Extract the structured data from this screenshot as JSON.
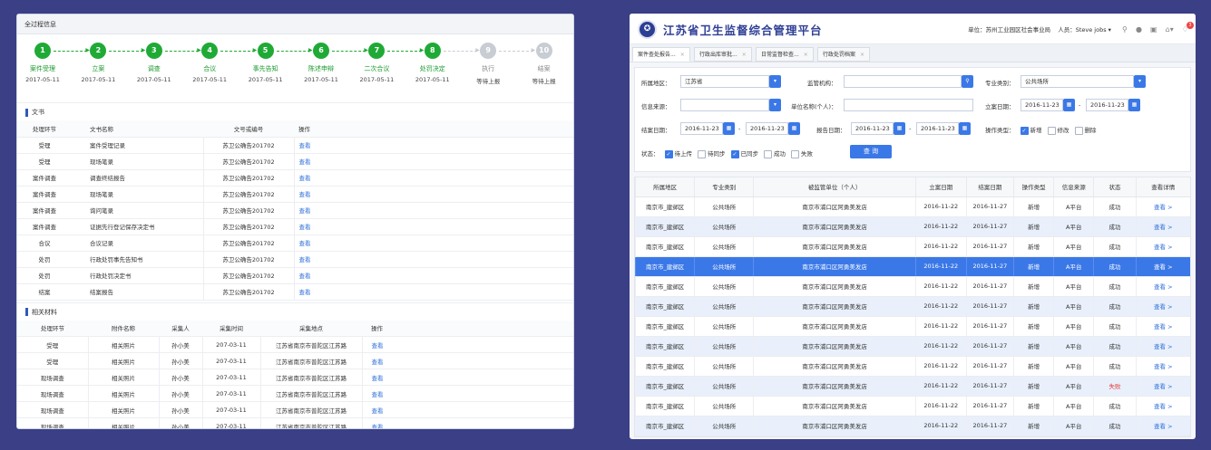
{
  "left_panel": {
    "title": "全过程信息",
    "steps": [
      {
        "num": "1",
        "name": "案件受理",
        "date": "2017-05-11",
        "done": true
      },
      {
        "num": "2",
        "name": "立案",
        "date": "2017-05-11",
        "done": true
      },
      {
        "num": "3",
        "name": "调查",
        "date": "2017-05-11",
        "done": true
      },
      {
        "num": "4",
        "name": "合议",
        "date": "2017-05-11",
        "done": true
      },
      {
        "num": "5",
        "name": "事先告知",
        "date": "2017-05-11",
        "done": true
      },
      {
        "num": "6",
        "name": "陈述申辩",
        "date": "2017-05-11",
        "done": true
      },
      {
        "num": "7",
        "name": "二次合议",
        "date": "2017-05-11",
        "done": true
      },
      {
        "num": "8",
        "name": "处罚决定",
        "date": "2017-05-11",
        "done": true
      },
      {
        "num": "9",
        "name": "执行",
        "date": "等待上报",
        "done": false
      },
      {
        "num": "10",
        "name": "结案",
        "date": "等待上报",
        "done": false
      }
    ],
    "documents": {
      "section_title": "文书",
      "headers": [
        "处理环节",
        "文书名称",
        "文号或编号",
        "操作"
      ],
      "rows": [
        {
          "stage": "受理",
          "name": "案件受理记录",
          "number": "苏卫公确告201702",
          "action": "查看"
        },
        {
          "stage": "受理",
          "name": "现场笔录",
          "number": "苏卫公确告201702",
          "action": "查看"
        },
        {
          "stage": "案件调查",
          "name": "调查终结报告",
          "number": "苏卫公确告201702",
          "action": "查看"
        },
        {
          "stage": "案件调查",
          "name": "现场笔录",
          "number": "苏卫公确告201702",
          "action": "查看"
        },
        {
          "stage": "案件调查",
          "name": "询问笔录",
          "number": "苏卫公确告201702",
          "action": "查看"
        },
        {
          "stage": "案件调查",
          "name": "证据先行登记保存决定书",
          "number": "苏卫公确告201702",
          "action": "查看"
        },
        {
          "stage": "合议",
          "name": "合议记录",
          "number": "苏卫公确告201702",
          "action": "查看"
        },
        {
          "stage": "处罚",
          "name": "行政处罚事先告知书",
          "number": "苏卫公确告201702",
          "action": "查看"
        },
        {
          "stage": "处罚",
          "name": "行政处罚决定书",
          "number": "苏卫公确告201702",
          "action": "查看"
        },
        {
          "stage": "结案",
          "name": "结案报告",
          "number": "苏卫公确告201702",
          "action": "查看"
        }
      ]
    },
    "materials": {
      "section_title": "相关材料",
      "headers": [
        "处理环节",
        "附件名称",
        "采集人",
        "采集时间",
        "采集地点",
        "操作"
      ],
      "rows": [
        {
          "stage": "受理",
          "name": "相关照片",
          "collector": "孙小美",
          "time": "207-03-11",
          "place": "江苏省南京市普陀区江苏路",
          "action": "查看"
        },
        {
          "stage": "受理",
          "name": "相关照片",
          "collector": "孙小美",
          "time": "207-03-11",
          "place": "江苏省南京市普陀区江苏路",
          "action": "查看"
        },
        {
          "stage": "现场调查",
          "name": "相关照片",
          "collector": "孙小美",
          "time": "207-03-11",
          "place": "江苏省南京市普陀区江苏路",
          "action": "查看"
        },
        {
          "stage": "现场调查",
          "name": "相关照片",
          "collector": "孙小美",
          "time": "207-03-11",
          "place": "江苏省南京市普陀区江苏路",
          "action": "查看"
        },
        {
          "stage": "现场调查",
          "name": "相关照片",
          "collector": "孙小美",
          "time": "207-03-11",
          "place": "江苏省南京市普陀区江苏路",
          "action": "查看"
        },
        {
          "stage": "现场调查",
          "name": "相关照片",
          "collector": "孙小美",
          "time": "207-03-11",
          "place": "江苏省南京市普陀区江苏路",
          "action": "查看"
        }
      ]
    }
  },
  "right_panel": {
    "app_title": "江苏省卫生监督综合管理平台",
    "unit_label": "单位：苏州工业园区社会事业局",
    "person_label": "人员：Steve jobs",
    "person_caret": "▾",
    "badge_count": "3",
    "icons": {
      "search": "search-icon",
      "chat": "chat-icon",
      "message": "message-icon",
      "home": "home-icon",
      "bell": "bell-icon"
    },
    "tabs": [
      "案件查处报告...",
      "行政出库审批...",
      "日常监督检查...",
      "行政处罚档案"
    ],
    "tab_close": "×",
    "filters": {
      "region_label": "所属地区：",
      "region_value": "江苏省",
      "agency_label": "监管机构：",
      "agency_value": "",
      "category_label": "专业类别：",
      "category_value": "公共场所",
      "source_label": "信息来源：",
      "source_value": "",
      "unit_label": "单位名称(个人)：",
      "unit_value": "",
      "filing_date_label": "立案日期：",
      "filing_from": "2016-11-23",
      "filing_to": "2016-11-23",
      "close_date_label": "结案日期：",
      "close_from": "2016-11-23",
      "close_to": "2016-11-23",
      "report_date_label": "报告日期：",
      "report_from": "2016-11-23",
      "report_to": "2016-11-23",
      "range_sep": "-",
      "op_type_label": "操作类型：",
      "op_types": [
        {
          "label": "新增",
          "checked": true
        },
        {
          "label": "修改",
          "checked": false
        },
        {
          "label": "删除",
          "checked": false
        }
      ],
      "status_label": "状态：",
      "statuses": [
        {
          "label": "待上传",
          "checked": true
        },
        {
          "label": "待同步",
          "checked": false
        },
        {
          "label": "已同步",
          "checked": true
        },
        {
          "label": "成功",
          "checked": false
        },
        {
          "label": "失败",
          "checked": false
        }
      ],
      "query_button": "查 询"
    },
    "table": {
      "headers": [
        "所属地区",
        "专业类别",
        "被监管单位（个人）",
        "立案日期",
        "结案日期",
        "操作类型",
        "信息来源",
        "状态",
        "查看详情"
      ],
      "rows": [
        {
          "region": "南京市_建邺区",
          "category": "公共场所",
          "unit": "南京市浦口区阿勇美发店",
          "filed": "2016-11-22",
          "closed": "2016-11-27",
          "op": "新增",
          "source": "A平台",
          "status": "成功",
          "detail": "查看 >",
          "style": ""
        },
        {
          "region": "南京市_建邺区",
          "category": "公共场所",
          "unit": "南京市浦口区阿勇美发店",
          "filed": "2016-11-22",
          "closed": "2016-11-27",
          "op": "新增",
          "source": "A平台",
          "status": "成功",
          "detail": "查看 >",
          "style": "alt"
        },
        {
          "region": "南京市_建邺区",
          "category": "公共场所",
          "unit": "南京市浦口区阿勇美发店",
          "filed": "2016-11-22",
          "closed": "2016-11-27",
          "op": "新增",
          "source": "A平台",
          "status": "成功",
          "detail": "查看 >",
          "style": ""
        },
        {
          "region": "南京市_建邺区",
          "category": "公共场所",
          "unit": "南京市浦口区阿勇美发店",
          "filed": "2016-11-22",
          "closed": "2016-11-27",
          "op": "新增",
          "source": "A平台",
          "status": "成功",
          "detail": "查看 >",
          "style": "sel"
        },
        {
          "region": "南京市_建邺区",
          "category": "公共场所",
          "unit": "南京市浦口区阿勇美发店",
          "filed": "2016-11-22",
          "closed": "2016-11-27",
          "op": "新增",
          "source": "A平台",
          "status": "成功",
          "detail": "查看 >",
          "style": ""
        },
        {
          "region": "南京市_建邺区",
          "category": "公共场所",
          "unit": "南京市浦口区阿勇美发店",
          "filed": "2016-11-22",
          "closed": "2016-11-27",
          "op": "新增",
          "source": "A平台",
          "status": "成功",
          "detail": "查看 >",
          "style": "alt"
        },
        {
          "region": "南京市_建邺区",
          "category": "公共场所",
          "unit": "南京市浦口区阿勇美发店",
          "filed": "2016-11-22",
          "closed": "2016-11-27",
          "op": "新增",
          "source": "A平台",
          "status": "成功",
          "detail": "查看 >",
          "style": ""
        },
        {
          "region": "南京市_建邺区",
          "category": "公共场所",
          "unit": "南京市浦口区阿勇美发店",
          "filed": "2016-11-22",
          "closed": "2016-11-27",
          "op": "新增",
          "source": "A平台",
          "status": "成功",
          "detail": "查看 >",
          "style": "alt"
        },
        {
          "region": "南京市_建邺区",
          "category": "公共场所",
          "unit": "南京市浦口区阿勇美发店",
          "filed": "2016-11-22",
          "closed": "2016-11-27",
          "op": "新增",
          "source": "A平台",
          "status": "成功",
          "detail": "查看 >",
          "style": ""
        },
        {
          "region": "南京市_建邺区",
          "category": "公共场所",
          "unit": "南京市浦口区阿勇美发店",
          "filed": "2016-11-22",
          "closed": "2016-11-27",
          "op": "新增",
          "source": "A平台",
          "status": "失败",
          "detail": "查看 >",
          "style": "alt"
        },
        {
          "region": "南京市_建邺区",
          "category": "公共场所",
          "unit": "南京市浦口区阿勇美发店",
          "filed": "2016-11-22",
          "closed": "2016-11-27",
          "op": "新增",
          "source": "A平台",
          "status": "成功",
          "detail": "查看 >",
          "style": ""
        },
        {
          "region": "南京市_建邺区",
          "category": "公共场所",
          "unit": "南京市浦口区阿勇美发店",
          "filed": "2016-11-22",
          "closed": "2016-11-27",
          "op": "新增",
          "source": "A平台",
          "status": "成功",
          "detail": "查看 >",
          "style": "alt"
        }
      ]
    }
  },
  "colors": {
    "background": "#3a3f86",
    "accent": "#3b78e7",
    "done_green": "#1faa36",
    "pending_gray": "#c8ccd3",
    "fail_red": "#e23b3b",
    "title_navy": "#2f3f95"
  }
}
